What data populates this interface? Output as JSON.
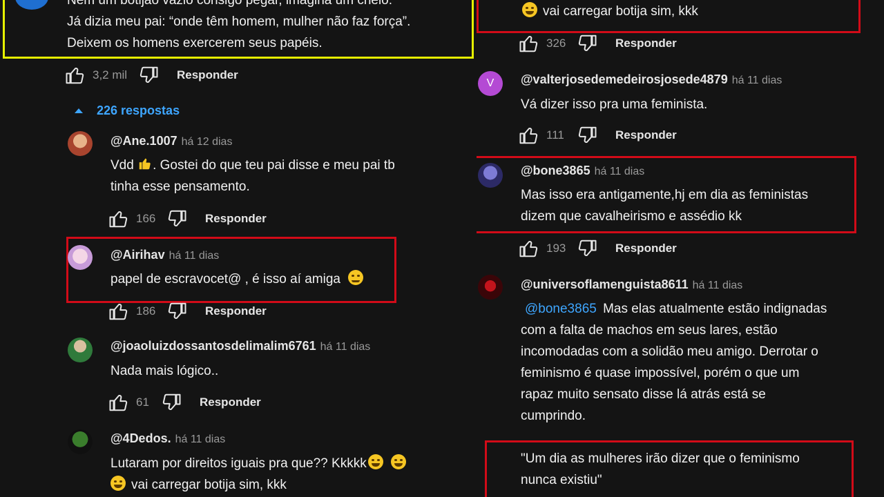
{
  "left": {
    "parent": {
      "lines": [
        "Nem um botijão vazio consigo pegar, imagina um cheio.",
        "Já dizia meu pai: “onde têm homem, mulher não faz força”.",
        "Deixem os homens exercerem seus papéis."
      ],
      "likes": "3,2 mil",
      "reply": "Responder"
    },
    "replies_toggle": "226 respostas",
    "comments": [
      {
        "user": "@Ane.1007",
        "time": "há 12 dias",
        "line1": "Vdd",
        "line1b": ".  Gostei do que teu pai disse e meu pai tb",
        "line2": "tinha esse pensamento.",
        "likes": "166",
        "reply": "Responder"
      },
      {
        "user": "@Airihav",
        "time": "há 11 dias",
        "line1": "papel de escravocet@ , é isso aí amiga",
        "likes": "186",
        "reply": "Responder"
      },
      {
        "user": "@joaoluizdossantosdelimalim6761",
        "time": "há 11 dias",
        "line1": "Nada mais lógico..",
        "likes": "61",
        "reply": "Responder"
      },
      {
        "user": "@4Dedos.",
        "time": "há 11 dias",
        "line1": "Lutaram por direitos iguais pra que?? Kkkkk",
        "line2": "vai carregar botija sim, kkk"
      }
    ]
  },
  "right": {
    "top": {
      "line": "vai carregar botija sim, kkk",
      "likes": "326",
      "reply": "Responder"
    },
    "comments": [
      {
        "avatar_letter": "V",
        "user": "@valterjosedemedeirosjosede4879",
        "time": "há 11 dias",
        "line1": "Vá dizer isso pra uma feminista.",
        "likes": "111",
        "reply": "Responder"
      },
      {
        "user": "@bone3865",
        "time": "há 11 dias",
        "line1": "Mas isso era antigamente,hj em dia as feministas",
        "line2": "dizem que cavalheirismo e assédio kk",
        "likes": "193",
        "reply": "Responder"
      },
      {
        "user": "@universoflamenguista8611",
        "time": "há 11 dias",
        "mention": "@bone3865",
        "line1": "Mas elas atualmente estão indignadas",
        "lines": [
          "com a falta de machos em seus lares, estão",
          "incomodadas com a solidão meu amigo. Derrotar o",
          "feminismo é quase impossível, porém o que um",
          "rapaz muito sensato disse lá atrás está se",
          "cumprindo."
        ]
      }
    ],
    "quote": [
      "\"Um dia as mulheres irão dizer que o feminismo",
      "nunca existiu\""
    ]
  },
  "colors": {
    "background": "#141414",
    "text": "#f1f1f1",
    "muted": "#9a9a9a",
    "link": "#3ea6ff",
    "highlight_red": "#d20b18",
    "highlight_yellow": "#e6f000",
    "avatar_v": "#b44ad4"
  },
  "icons": [
    "like-icon",
    "dislike-icon",
    "chevron-up-icon",
    "laughing-emoji",
    "smile-emoji",
    "thumbs-up-emoji"
  ]
}
